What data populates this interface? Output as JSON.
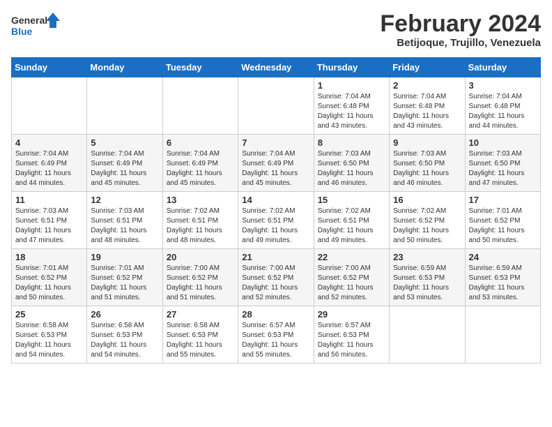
{
  "header": {
    "logo_general": "General",
    "logo_blue": "Blue",
    "title": "February 2024",
    "subtitle": "Betijoque, Trujillo, Venezuela"
  },
  "calendar": {
    "days_of_week": [
      "Sunday",
      "Monday",
      "Tuesday",
      "Wednesday",
      "Thursday",
      "Friday",
      "Saturday"
    ],
    "weeks": [
      [
        {
          "day": "",
          "info": ""
        },
        {
          "day": "",
          "info": ""
        },
        {
          "day": "",
          "info": ""
        },
        {
          "day": "",
          "info": ""
        },
        {
          "day": "1",
          "info": "Sunrise: 7:04 AM\nSunset: 6:48 PM\nDaylight: 11 hours\nand 43 minutes."
        },
        {
          "day": "2",
          "info": "Sunrise: 7:04 AM\nSunset: 6:48 PM\nDaylight: 11 hours\nand 43 minutes."
        },
        {
          "day": "3",
          "info": "Sunrise: 7:04 AM\nSunset: 6:48 PM\nDaylight: 11 hours\nand 44 minutes."
        }
      ],
      [
        {
          "day": "4",
          "info": "Sunrise: 7:04 AM\nSunset: 6:49 PM\nDaylight: 11 hours\nand 44 minutes."
        },
        {
          "day": "5",
          "info": "Sunrise: 7:04 AM\nSunset: 6:49 PM\nDaylight: 11 hours\nand 45 minutes."
        },
        {
          "day": "6",
          "info": "Sunrise: 7:04 AM\nSunset: 6:49 PM\nDaylight: 11 hours\nand 45 minutes."
        },
        {
          "day": "7",
          "info": "Sunrise: 7:04 AM\nSunset: 6:49 PM\nDaylight: 11 hours\nand 45 minutes."
        },
        {
          "day": "8",
          "info": "Sunrise: 7:03 AM\nSunset: 6:50 PM\nDaylight: 11 hours\nand 46 minutes."
        },
        {
          "day": "9",
          "info": "Sunrise: 7:03 AM\nSunset: 6:50 PM\nDaylight: 11 hours\nand 46 minutes."
        },
        {
          "day": "10",
          "info": "Sunrise: 7:03 AM\nSunset: 6:50 PM\nDaylight: 11 hours\nand 47 minutes."
        }
      ],
      [
        {
          "day": "11",
          "info": "Sunrise: 7:03 AM\nSunset: 6:51 PM\nDaylight: 11 hours\nand 47 minutes."
        },
        {
          "day": "12",
          "info": "Sunrise: 7:03 AM\nSunset: 6:51 PM\nDaylight: 11 hours\nand 48 minutes."
        },
        {
          "day": "13",
          "info": "Sunrise: 7:02 AM\nSunset: 6:51 PM\nDaylight: 11 hours\nand 48 minutes."
        },
        {
          "day": "14",
          "info": "Sunrise: 7:02 AM\nSunset: 6:51 PM\nDaylight: 11 hours\nand 49 minutes."
        },
        {
          "day": "15",
          "info": "Sunrise: 7:02 AM\nSunset: 6:51 PM\nDaylight: 11 hours\nand 49 minutes."
        },
        {
          "day": "16",
          "info": "Sunrise: 7:02 AM\nSunset: 6:52 PM\nDaylight: 11 hours\nand 50 minutes."
        },
        {
          "day": "17",
          "info": "Sunrise: 7:01 AM\nSunset: 6:52 PM\nDaylight: 11 hours\nand 50 minutes."
        }
      ],
      [
        {
          "day": "18",
          "info": "Sunrise: 7:01 AM\nSunset: 6:52 PM\nDaylight: 11 hours\nand 50 minutes."
        },
        {
          "day": "19",
          "info": "Sunrise: 7:01 AM\nSunset: 6:52 PM\nDaylight: 11 hours\nand 51 minutes."
        },
        {
          "day": "20",
          "info": "Sunrise: 7:00 AM\nSunset: 6:52 PM\nDaylight: 11 hours\nand 51 minutes."
        },
        {
          "day": "21",
          "info": "Sunrise: 7:00 AM\nSunset: 6:52 PM\nDaylight: 11 hours\nand 52 minutes."
        },
        {
          "day": "22",
          "info": "Sunrise: 7:00 AM\nSunset: 6:52 PM\nDaylight: 11 hours\nand 52 minutes."
        },
        {
          "day": "23",
          "info": "Sunrise: 6:59 AM\nSunset: 6:53 PM\nDaylight: 11 hours\nand 53 minutes."
        },
        {
          "day": "24",
          "info": "Sunrise: 6:59 AM\nSunset: 6:53 PM\nDaylight: 11 hours\nand 53 minutes."
        }
      ],
      [
        {
          "day": "25",
          "info": "Sunrise: 6:58 AM\nSunset: 6:53 PM\nDaylight: 11 hours\nand 54 minutes."
        },
        {
          "day": "26",
          "info": "Sunrise: 6:58 AM\nSunset: 6:53 PM\nDaylight: 11 hours\nand 54 minutes."
        },
        {
          "day": "27",
          "info": "Sunrise: 6:58 AM\nSunset: 6:53 PM\nDaylight: 11 hours\nand 55 minutes."
        },
        {
          "day": "28",
          "info": "Sunrise: 6:57 AM\nSunset: 6:53 PM\nDaylight: 11 hours\nand 55 minutes."
        },
        {
          "day": "29",
          "info": "Sunrise: 6:57 AM\nSunset: 6:53 PM\nDaylight: 11 hours\nand 56 minutes."
        },
        {
          "day": "",
          "info": ""
        },
        {
          "day": "",
          "info": ""
        }
      ]
    ]
  }
}
